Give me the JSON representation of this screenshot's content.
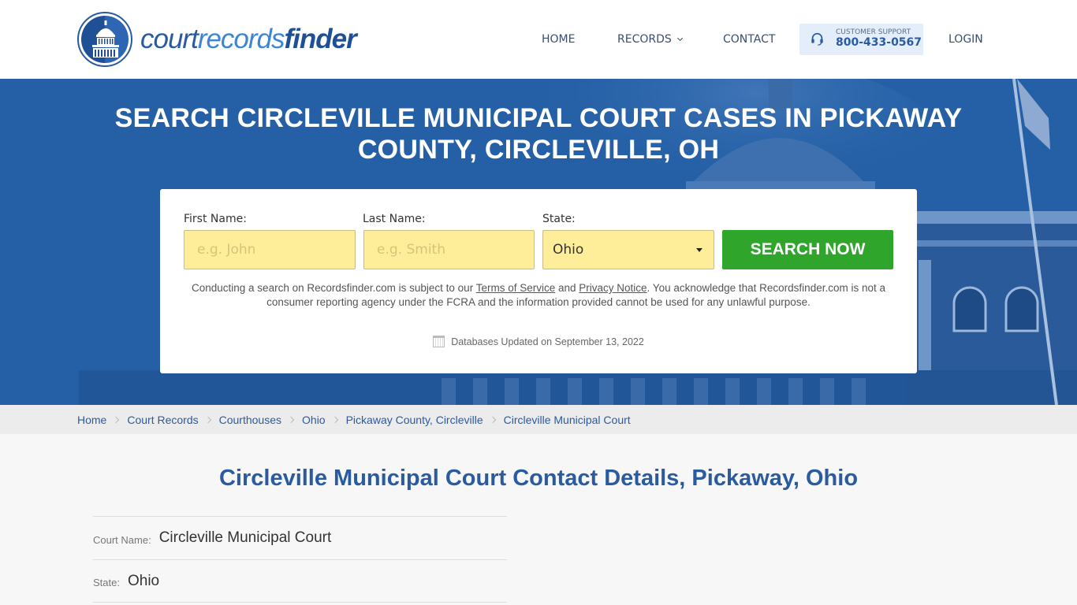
{
  "header": {
    "logo": {
      "part1": "court",
      "part2": "records",
      "part3": "finder"
    },
    "nav": {
      "home": "HOME",
      "records": "RECORDS",
      "contact": "CONTACT",
      "login": "LOGIN"
    },
    "support": {
      "label": "CUSTOMER SUPPORT",
      "phone": "800-433-0567"
    }
  },
  "hero": {
    "title": "SEARCH CIRCLEVILLE MUNICIPAL COURT CASES IN PICKAWAY COUNTY, CIRCLEVILLE, OH",
    "form": {
      "first_name_label": "First Name:",
      "first_name_placeholder": "e.g. John",
      "first_name_value": "",
      "last_name_label": "Last Name:",
      "last_name_placeholder": "e.g. Smith",
      "last_name_value": "",
      "state_label": "State:",
      "state_value": "Ohio",
      "search_button": "SEARCH NOW"
    },
    "disclaimer": {
      "part1": "Conducting a search on Recordsfinder.com is subject to our ",
      "terms_link": "Terms of Service",
      "part2": " and ",
      "privacy_link": "Privacy Notice",
      "part3": ". You acknowledge that Recordsfinder.com is not a consumer reporting agency under the FCRA and the information provided cannot be used for any unlawful purpose."
    },
    "db_updated": "Databases Updated on September 13, 2022"
  },
  "breadcrumb": [
    "Home",
    "Court Records",
    "Courthouses",
    "Ohio",
    "Pickaway County, Circleville",
    "Circleville Municipal Court"
  ],
  "main": {
    "title": "Circleville Municipal Court Contact Details, Pickaway, Ohio",
    "details": [
      {
        "key": "Court Name:",
        "value": "Circleville Municipal Court"
      },
      {
        "key": "State:",
        "value": "Ohio"
      }
    ]
  },
  "colors": {
    "brand_blue": "#2a5aa0",
    "hero_blue": "#2560a6",
    "input_yellow": "#ffee99",
    "search_green": "#2fa52c",
    "support_bg": "#e3eefa"
  }
}
